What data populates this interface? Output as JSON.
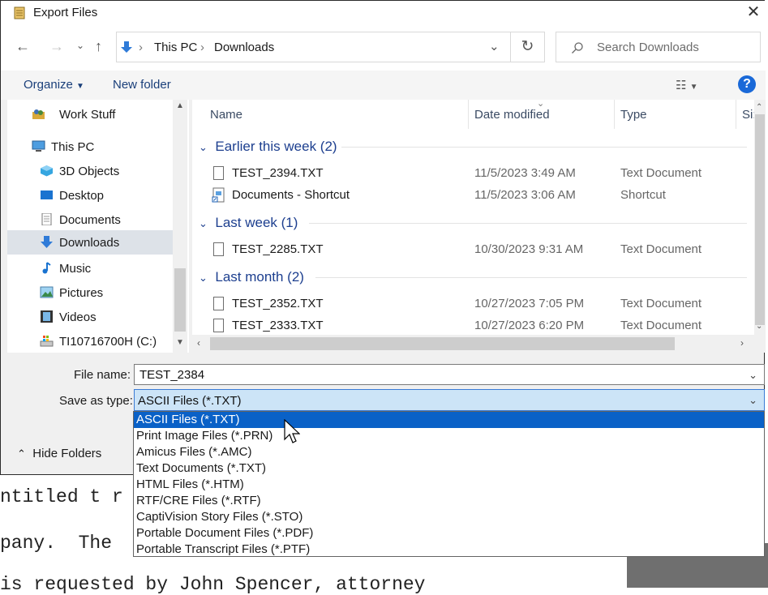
{
  "background_doc": {
    "lines": [
      "ntitled t r",
      "pany.  The",
      "is requested by John Spencer, attorney"
    ]
  },
  "dialog": {
    "title": "Export Files",
    "nav": {
      "breadcrumb": [
        "This PC",
        "Downloads"
      ],
      "search_placeholder": "Search Downloads"
    },
    "toolbar": {
      "organize": "Organize",
      "new_folder": "New folder",
      "help": "?"
    },
    "sidebar": {
      "items": [
        {
          "label": "Work Stuff",
          "icon": "people-folder-icon"
        },
        {
          "label": "This PC",
          "icon": "computer-icon"
        },
        {
          "label": "3D Objects",
          "icon": "cube-icon"
        },
        {
          "label": "Desktop",
          "icon": "desktop-icon"
        },
        {
          "label": "Documents",
          "icon": "documents-icon"
        },
        {
          "label": "Downloads",
          "icon": "download-arrow-icon",
          "selected": true
        },
        {
          "label": "Music",
          "icon": "music-note-icon"
        },
        {
          "label": "Pictures",
          "icon": "pictures-icon"
        },
        {
          "label": "Videos",
          "icon": "film-icon"
        },
        {
          "label": "TI10716700H (C:)",
          "icon": "drive-icon"
        }
      ]
    },
    "columns": [
      "Name",
      "Date modified",
      "Type",
      "Si:"
    ],
    "groups": [
      {
        "label": "Earlier this week (2)",
        "files": [
          {
            "name": "TEST_2394.TXT",
            "date": "11/5/2023 3:49 AM",
            "type": "Text Document",
            "icon": "text-file-icon"
          },
          {
            "name": "Documents - Shortcut",
            "date": "11/5/2023 3:06 AM",
            "type": "Shortcut",
            "icon": "shortcut-icon"
          }
        ]
      },
      {
        "label": "Last week (1)",
        "files": [
          {
            "name": "TEST_2285.TXT",
            "date": "10/30/2023 9:31 AM",
            "type": "Text Document",
            "icon": "text-file-icon"
          }
        ]
      },
      {
        "label": "Last month (2)",
        "files": [
          {
            "name": "TEST_2352.TXT",
            "date": "10/27/2023 7:05 PM",
            "type": "Text Document",
            "icon": "text-file-icon"
          },
          {
            "name": "TEST_2333.TXT",
            "date": "10/27/2023 6:20 PM",
            "type": "Text Document",
            "icon": "text-file-icon"
          }
        ]
      }
    ],
    "form": {
      "file_name_label": "File name:",
      "file_name_value": "TEST_2384",
      "save_as_label": "Save as type:",
      "save_as_value": "ASCII Files (*.TXT)",
      "hide_folders": "Hide Folders"
    },
    "save_as_options": [
      "ASCII Files (*.TXT)",
      "Print Image Files (*.PRN)",
      "Amicus Files (*.AMC)",
      "Text Documents (*.TXT)",
      "HTML Files (*.HTM)",
      "RTF/CRE Files (*.RTF)",
      "CaptiVision Story Files (*.STO)",
      "Portable Document Files (*.PDF)",
      "Portable Transcript Files (*.PTF)"
    ],
    "highlighted_option": "ASCII Files (*.TXT)",
    "colors": {
      "accent": "#0a61c7",
      "group_header": "#1d3f8f",
      "selection": "#dde2e8"
    }
  }
}
